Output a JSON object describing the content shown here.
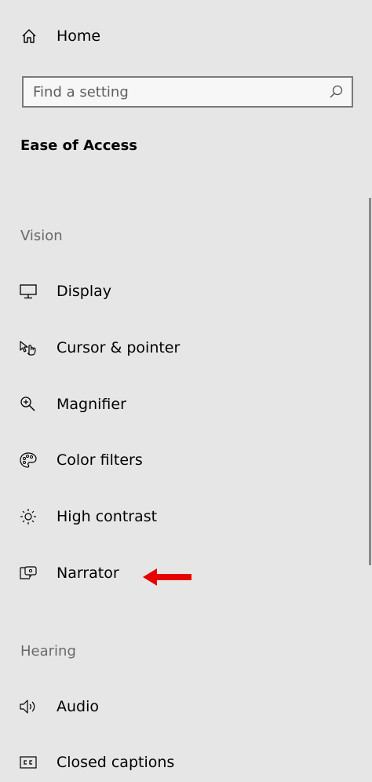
{
  "nav": {
    "home_label": "Home",
    "search_placeholder": "Find a setting",
    "section_title": "Ease of Access",
    "vision_header": "Vision",
    "hearing_header": "Hearing",
    "items": [
      {
        "label": "Display",
        "icon": "display-icon"
      },
      {
        "label": "Cursor & pointer",
        "icon": "cursor-pointer-icon"
      },
      {
        "label": "Magnifier",
        "icon": "magnifier-icon"
      },
      {
        "label": "Color filters",
        "icon": "color-filters-icon"
      },
      {
        "label": "High contrast",
        "icon": "high-contrast-icon"
      },
      {
        "label": "Narrator",
        "icon": "narrator-icon"
      },
      {
        "label": "Audio",
        "icon": "audio-icon"
      },
      {
        "label": "Closed captions",
        "icon": "closed-captions-icon"
      }
    ]
  },
  "colors": {
    "background": "#e6e6e6",
    "annotation_arrow": "#e60000",
    "group_header": "#6a6a6a"
  }
}
